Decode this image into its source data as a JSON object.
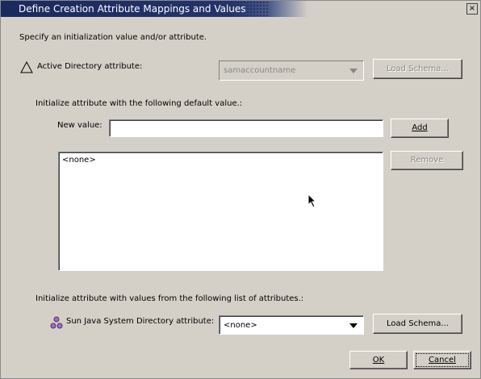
{
  "window": {
    "title": "Define Creation Attribute Mappings and Values",
    "close_label": "×"
  },
  "intro": "Specify an initialization value and/or attribute.",
  "ad": {
    "label": "Active Directory attribute:",
    "combo_value": "samaccountname",
    "load_schema_label": "Load Schema..."
  },
  "defaults": {
    "heading": "Initialize attribute with the following default value.:",
    "new_value_label": "New value:",
    "new_value": "",
    "add_label": "Add",
    "remove_label": "Remove",
    "list_items": [
      "<none>"
    ]
  },
  "from_list": {
    "heading": "Initialize attribute with values from the following list of attributes.:",
    "sun_label": "Sun Java System Directory attribute:",
    "combo_value": "<none>",
    "load_schema_label": "Load Schema..."
  },
  "footer": {
    "ok_label": "OK",
    "cancel_label": "Cancel"
  }
}
